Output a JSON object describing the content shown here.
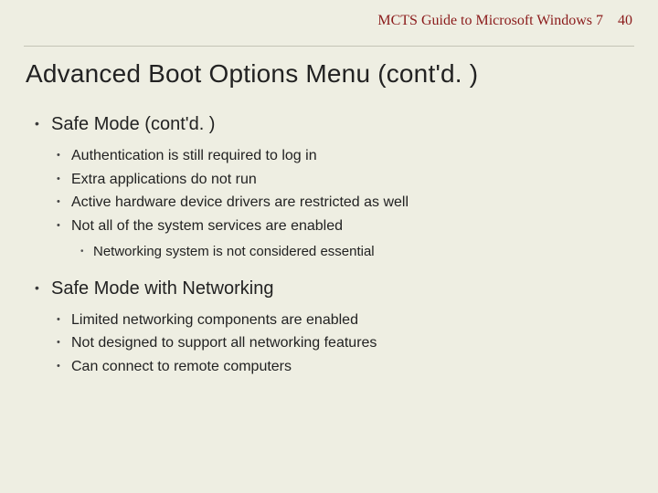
{
  "header": {
    "title": "MCTS Guide to Microsoft Windows 7",
    "page": "40"
  },
  "slide": {
    "title": "Advanced Boot Options Menu (cont'd. )"
  },
  "sections": {
    "s1": {
      "heading": "Safe Mode (cont'd. )",
      "items": {
        "a": "Authentication is still required to log in",
        "b": "Extra applications do not run",
        "c": "Active hardware device drivers are restricted as well",
        "d": "Not all of the system services are enabled",
        "d_sub": {
          "a": "Networking system is not considered essential"
        }
      }
    },
    "s2": {
      "heading": "Safe Mode with Networking",
      "items": {
        "a": "Limited networking components are enabled",
        "b": "Not designed to support all networking features",
        "c": "Can connect to remote computers"
      }
    }
  }
}
